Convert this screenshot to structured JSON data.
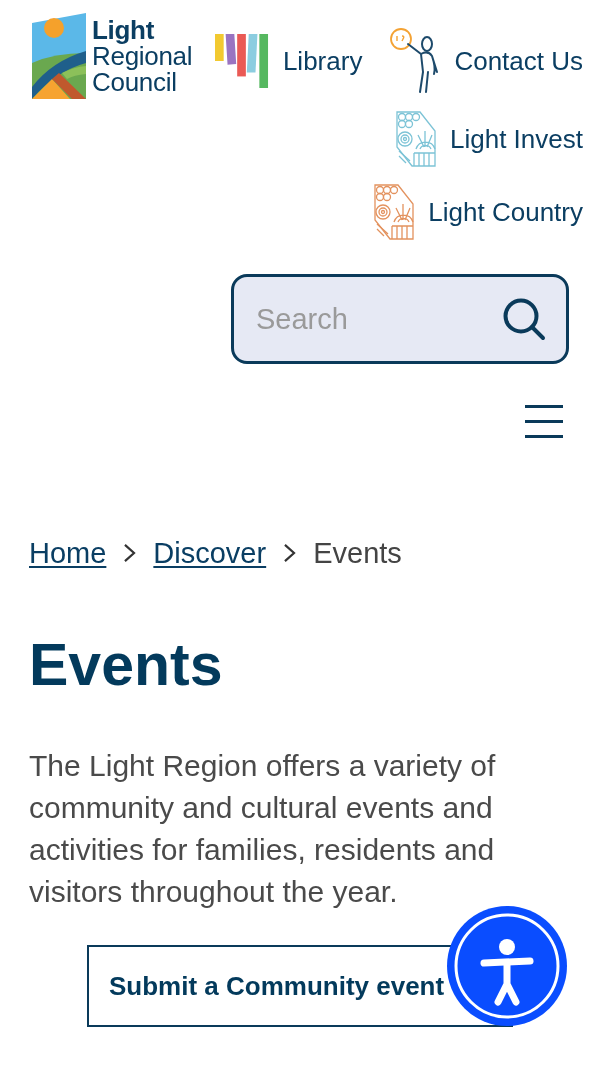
{
  "logo": {
    "wordmark": "**Light** Regional Council"
  },
  "nav": [
    {
      "label": "Library",
      "kind": "bars"
    },
    {
      "label": "Contact Us",
      "kind": "person"
    },
    {
      "label": "Light Invest",
      "kind": "tile",
      "color": "#7cc3d6"
    },
    {
      "label": "Light Country",
      "kind": "tile",
      "color": "#e3925e"
    }
  ],
  "search": {
    "placeholder": "Search"
  },
  "breadcrumb": [
    {
      "label": "Home",
      "kind": "link"
    },
    {
      "label": "Discover",
      "kind": "link"
    },
    {
      "label": "Events",
      "kind": "current"
    }
  ],
  "page": {
    "title": "Events",
    "intro": "The Light Region offers a variety of community and cultural events and activities for families, residents and visitors throughout the year.",
    "button": "Submit a Community event"
  }
}
